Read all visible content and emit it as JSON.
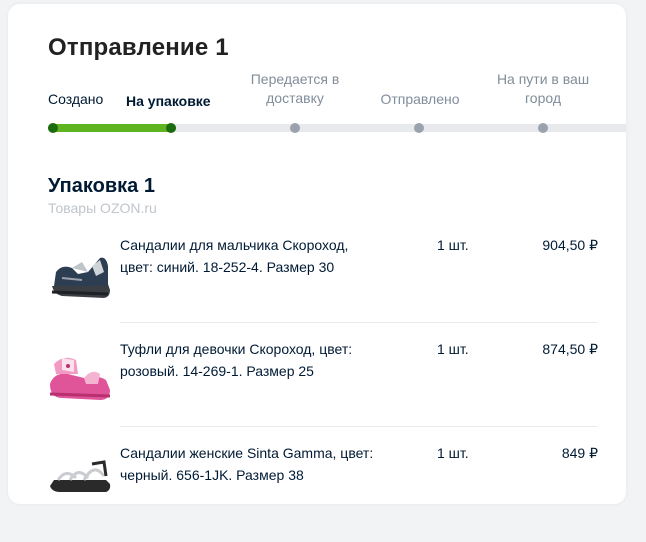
{
  "shipment": {
    "title": "Отправление 1",
    "steps": [
      {
        "label": "Создано",
        "state": "done"
      },
      {
        "label": "На упаковке",
        "state": "active"
      },
      {
        "label": "Передается в доставку",
        "state": "pending"
      },
      {
        "label": "Отправлено",
        "state": "pending"
      },
      {
        "label": "На пути в ваш город",
        "state": "pending"
      }
    ],
    "progress_completed_steps": 2,
    "progress_total_steps": 5
  },
  "package": {
    "title": "Упаковка 1",
    "seller": "Товары OZON.ru",
    "items": [
      {
        "name": "Сандалии для мальчика Скороход, цвет: синий. 18-252-4. Размер 30",
        "qty": "1 шт.",
        "price": "904,50 ₽",
        "image_icon": "boy-sandal-icon"
      },
      {
        "name": "Туфли для девочки Скороход, цвет: розовый. 14-269-1. Размер 25",
        "qty": "1 шт.",
        "price": "874,50 ₽",
        "image_icon": "girl-shoe-icon"
      },
      {
        "name": "Сандалии женские Sinta Gamma, цвет: черный. 656-1JK. Размер 38",
        "qty": "1 шт.",
        "price": "849 ₽",
        "image_icon": "women-sandal-icon"
      }
    ]
  },
  "colors": {
    "progress_green": "#5eb51f",
    "progress_dot_done": "#1c6b0f",
    "progress_track": "#e8e9ec",
    "muted_text": "#808d9a"
  }
}
